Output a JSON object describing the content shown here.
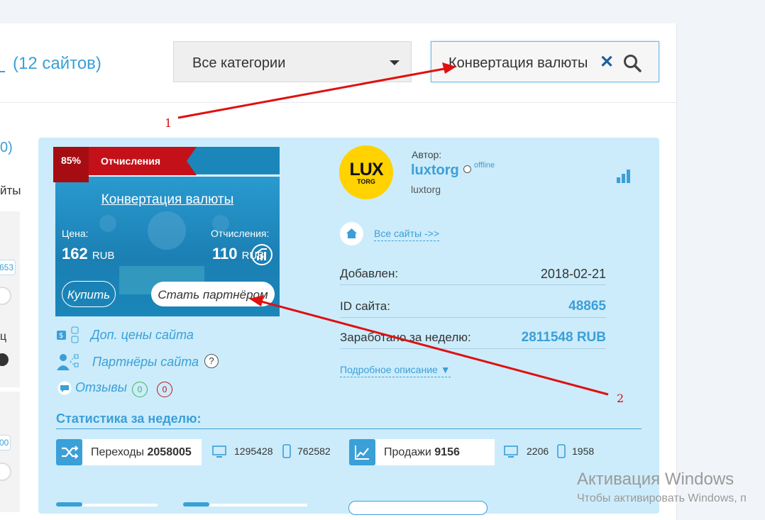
{
  "header": {
    "site_count": "(12 сайтов)",
    "category_select": "Все категории",
    "search_value": "Конвертация валюты"
  },
  "left_sidebar": {
    "fragment_1": "0)",
    "fragment_2": "йты",
    "input_1": "653",
    "fragment_3": "ц",
    "input_2": "00"
  },
  "card": {
    "ribbon_percent": "85%",
    "ribbon_label": "Отчисления",
    "title": "Конвертация валюты",
    "price_label": "Цена:",
    "price_value": "162",
    "price_currency": "RUB",
    "commission_label": "Отчисления:",
    "commission_value": "110",
    "commission_currency": "RUB",
    "buy_button": "Купить",
    "partner_button": "Стать партнёром",
    "link_prices": "Доп. цены сайта",
    "link_partners": "Партнёры сайта",
    "help": "?",
    "link_reviews": "Отзывы",
    "reviews_positive": "0",
    "reviews_negative": "0",
    "author_label": "Автор:",
    "author_name": "luxtorg",
    "author_status": "offline",
    "author_sub": "luxtorg",
    "logo_text": "LUX",
    "logo_sub": "TORG",
    "all_sites": "Все сайты ->>",
    "added_label": "Добавлен:",
    "added_value": "2018-02-21",
    "id_label": "ID сайта:",
    "id_value": "48865",
    "earned_label": "Заработано за неделю:",
    "earned_value": "2811548 RUB",
    "more_link": "Подробное описание ▼",
    "stats_title": "Статистика за неделю:",
    "transitions_label": "Переходы",
    "transitions_value": "2058005",
    "desktop_transitions": "1295428",
    "mobile_transitions": "762582",
    "sales_label": "Продажи",
    "sales_value": "9156",
    "desktop_sales": "2206",
    "mobile_sales": "1958"
  },
  "annotations": {
    "label_1": "1",
    "label_2": "2",
    "color": "#e01010"
  },
  "watermark": {
    "title": "Активация Windows",
    "subtitle": "Чтобы активировать Windows, п"
  },
  "colors": {
    "accent": "#3b9fd8",
    "card_bg": "#ccecfb",
    "ribbon": "#c41119",
    "logo": "#ffd200"
  }
}
